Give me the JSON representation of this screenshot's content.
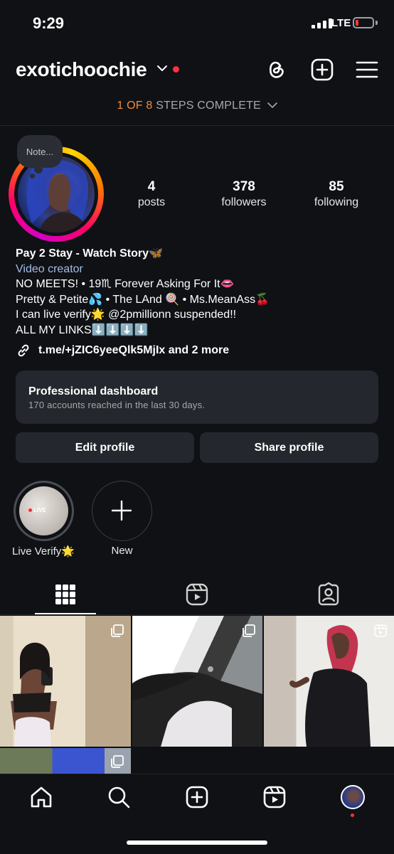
{
  "status_bar": {
    "time": "9:29",
    "network": "LTE"
  },
  "header": {
    "username": "exotichoochie",
    "steps_done": "1 OF 8",
    "steps_rest": "STEPS COMPLETE"
  },
  "profile": {
    "note": "Note...",
    "stats": [
      {
        "value": "4",
        "label": "posts"
      },
      {
        "value": "378",
        "label": "followers"
      },
      {
        "value": "85",
        "label": "following"
      }
    ],
    "bio_name": "Pay 2 Stay - Watch Story🦋",
    "category": "Video creator",
    "bio_lines": [
      "NO MEETS! • 19♏ Forever Asking For It👄",
      "Pretty & Petite💦 • The LAnd 🍭 • Ms.MeanAss🍒",
      "I can live verify🌟 @2pmillionn suspended!!",
      "ALL MY LINKS⬇️⬇️⬇️⬇️"
    ],
    "link": "t.me/+jZIC6yeeQlk5MjIx and 2 more"
  },
  "dashboard": {
    "title": "Professional dashboard",
    "subtitle": "170 accounts reached in the last 30 days."
  },
  "buttons": {
    "edit": "Edit profile",
    "share": "Share profile"
  },
  "highlights": [
    {
      "label": "Live Verify🌟",
      "badge": "LIVE"
    },
    {
      "label": "New"
    }
  ],
  "colors": {
    "accent_orange": "#f58a3c",
    "notification_red": "#ff3040",
    "background": "#0f1115"
  }
}
